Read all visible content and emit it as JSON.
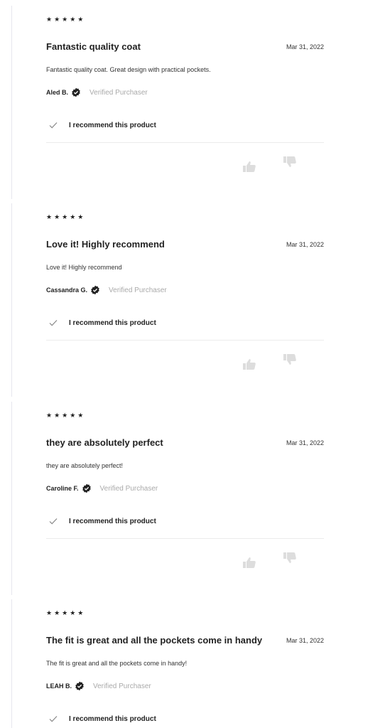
{
  "reviews": [
    {
      "stars": "★★★★★",
      "title": "Fantastic quality coat",
      "date": "Mar 31, 2022",
      "body": "Fantastic quality coat. Great design with practical pockets.",
      "author": "Aled B.",
      "verified": "Verified Purchaser",
      "recommend": "I recommend this product"
    },
    {
      "stars": "★★★★★",
      "title": "Love it! Highly recommend",
      "date": "Mar 31, 2022",
      "body": "Love it! Highly recommend",
      "author": "Cassandra G.",
      "verified": "Verified Purchaser",
      "recommend": "I recommend this product"
    },
    {
      "stars": "★★★★★",
      "title": "they are absolutely perfect",
      "date": "Mar 31, 2022",
      "body": "they are absolutely perfect!",
      "author": "Caroline F.",
      "verified": "Verified Purchaser",
      "recommend": "I recommend this product"
    },
    {
      "stars": "★★★★★",
      "title": "The fit is great and all the pockets come in handy",
      "date": "Mar 31, 2022",
      "body": "The fit is great and all the pockets come in handy!",
      "author": "LEAH B.",
      "verified": "Verified Purchaser",
      "recommend": "I recommend this product"
    }
  ],
  "icons": {
    "rating": "star-icon",
    "verified": "verified-badge-icon",
    "recommend": "checkmark-icon",
    "helpful": "thumbs-up-icon",
    "not_helpful": "thumbs-down-icon"
  },
  "colors": {
    "text": "#222222",
    "muted": "#aaaaaa",
    "thumb": "#dddddd",
    "divider": "#ececec"
  }
}
